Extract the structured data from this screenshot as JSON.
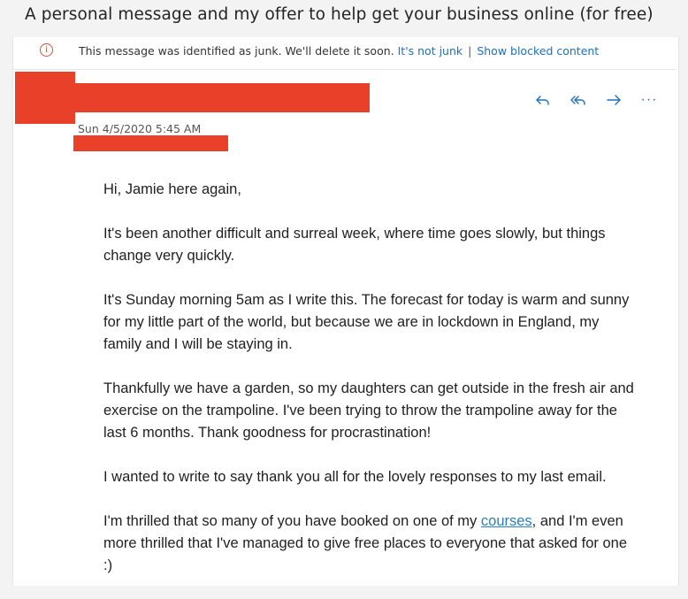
{
  "subject": "A personal message and my offer to help get your business online (for free)",
  "junk_bar": {
    "icon": "info-icon",
    "message": "This message was identified as junk. We'll delete it soon.",
    "not_junk_link": "It's not junk",
    "separator": "|",
    "show_blocked_link": "Show blocked content"
  },
  "header": {
    "date": "Sun 4/5/2020 5:45 AM",
    "actions": [
      "reply-icon",
      "reply-all-icon",
      "forward-icon",
      "more-actions-icon"
    ],
    "more_label": "···",
    "redaction_color": "#e9402a",
    "accent_color": "#1f6fc5"
  },
  "body": {
    "p1": "Hi, Jamie here again,",
    "p2": "It's been another difficult and surreal week, where time goes slowly, but things change very quickly.",
    "p3": "It's Sunday morning 5am as I write this.  The forecast for today is warm and sunny for my little part of the world, but because we are in lockdown in England, my family and I will be staying in.",
    "p4": "Thankfully we have a garden, so my daughters can get outside in the fresh air and exercise on the trampoline. I've been trying to throw the trampoline away for the last 6 months. Thank goodness for procrastination!",
    "p5": "I wanted to write to say thank you all for the lovely responses to my last email.",
    "p6_before": "I'm thrilled that so many of you have booked on one of my ",
    "p6_link": "courses",
    "p6_after": ", and I'm even more thrilled that I've managed to give free places to everyone that asked for one :)"
  }
}
